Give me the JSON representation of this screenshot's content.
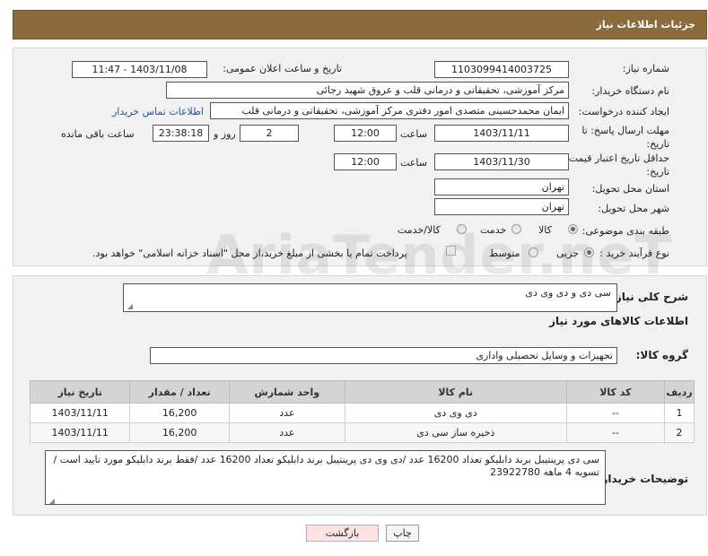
{
  "header": {
    "title": "جزئیات اطلاعات نیاز"
  },
  "form": {
    "need_number_label": "شماره نیاز:",
    "need_number": "1103099414003725",
    "announce_label": "تاریخ و ساعت اعلان عمومی:",
    "announce_value": "1403/11/08 - 11:47",
    "buyer_org_label": "نام دستگاه خریدار:",
    "buyer_org": "مرکز آموزشی، تحقیقاتی و درمانی قلب و عروق شهید رجائی",
    "requester_label": "ایجاد کننده درخواست:",
    "requester": "ایمان محمدحسینی متصدی امور دفتری مرکز آموزشی، تحقیقاتی و درمانی قلب",
    "contact_link": "اطلاعات تماس خریدار",
    "deadline_label": "مهلت ارسال پاسخ: تا تاریخ:",
    "deadline_date": "1403/11/11",
    "time_label": "ساعت",
    "deadline_time": "12:00",
    "days_value": "2",
    "days_label": "روز و",
    "remaining_time": "23:38:18",
    "remaining_label": "ساعت باقی مانده",
    "validity_label": "حداقل تاریخ اعتبار قیمت: تا تاریخ:",
    "validity_date": "1403/11/30",
    "validity_time": "12:00",
    "province_label": "استان محل تحویل:",
    "province": "تهران",
    "city_label": "شهر محل تحویل:",
    "city": "تهران",
    "category_label": "طبقه بندی موضوعی:",
    "category_options": [
      "کالا",
      "خدمت",
      "کالا/خدمت"
    ],
    "process_label": "نوع فرآیند خرید :",
    "process_options": [
      "جزیی",
      "متوسط"
    ],
    "payment_note": "پرداخت تمام یا بخشی از مبلغ خرید،از محل \"اسناد خزانه اسلامی\" خواهد بود."
  },
  "general": {
    "desc_label": "شرح کلی نیاز:",
    "desc_value": "سی دی و دی وی دی",
    "goods_info_title": "اطلاعات کالاهای مورد نیاز",
    "group_label": "گروه کالا:",
    "group_value": "تجهیزات و وسایل تحصیلی واداری"
  },
  "table": {
    "headers": [
      "ردیف",
      "کد کالا",
      "نام کالا",
      "واحد شمارش",
      "تعداد / مقدار",
      "تاریخ نیاز"
    ],
    "rows": [
      [
        "1",
        "--",
        "دی وی دی",
        "عدد",
        "16,200",
        "1403/11/11"
      ],
      [
        "2",
        "--",
        "ذخیره ساز سی دی",
        "عدد",
        "16,200",
        "1403/11/11"
      ]
    ]
  },
  "buyer_notes": {
    "label": "توضیحات خریدار:",
    "text": "سی دی پرینتیبل برند دابلیکو تعداد 16200 عدد /دی وی دی پرینتیبل برند دابلیکو تعداد 16200 عدد /فقط برند دابلیکو مورد تایید است /تسویه 4 ماهه 23922780"
  },
  "buttons": {
    "print": "چاپ",
    "back": "بازگشت"
  },
  "watermark": "AriaTender.neT"
}
